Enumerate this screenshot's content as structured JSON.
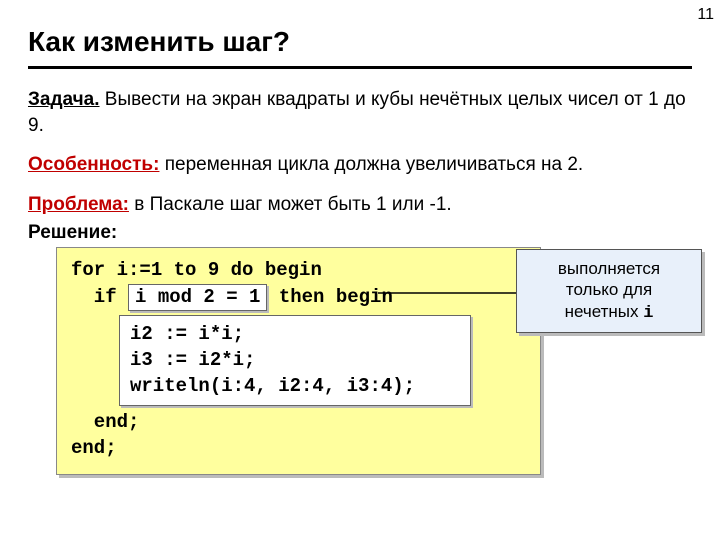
{
  "page_number": "11",
  "title": "Как изменить шаг?",
  "task": {
    "label": "Задача.",
    "text": " Вывести на экран квадраты и кубы нечётных целых чисел от 1 до 9."
  },
  "feature": {
    "label": "Особенность:",
    "text": " переменная цикла должна увеличиваться на 2."
  },
  "problem": {
    "label": "Проблема:",
    "text": " в Паскале шаг может быть 1 или -1."
  },
  "solution": {
    "label": "Решение:"
  },
  "code": {
    "l1": "for i:=1 to 9 do begin",
    "l2a": "  if ",
    "cond": "i mod 2 = 1",
    "l2b": " then begin",
    "inner1": "i2 := i*i;",
    "inner2": "i3 := i2*i;",
    "inner3": "writeln(i:4, i2:4, i3:4);",
    "l3": "  end;",
    "l4": "end;"
  },
  "callout": {
    "line1": "выполняется",
    "line2": "только для",
    "line3_a": "нечетных ",
    "line3_b": "i"
  }
}
